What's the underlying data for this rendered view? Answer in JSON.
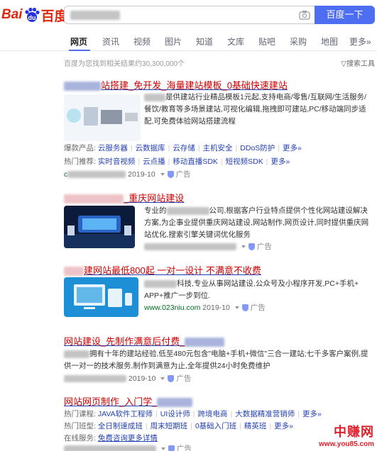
{
  "header": {
    "logo_bai": "Bai",
    "logo_du": "百度",
    "search_button": "百度一下"
  },
  "tabs": [
    "网页",
    "资讯",
    "视频",
    "图片",
    "知道",
    "文库",
    "贴吧",
    "采购",
    "地图",
    "更多»"
  ],
  "stats": "百度为您找到相关结果约30,300,000个",
  "search_tools": "搜索工具",
  "results": {
    "r1": {
      "title_tail": "站搭建_免开发_海量建站模板_0基础快速建站",
      "desc1": "是供建站行业精品模板1元起,支持电商/零售/互联网/生活服务/",
      "desc2": "餐饮/教育等多场景建站,可视化编辑,拖拽即可建站,PC/移动端同步适",
      "desc3": "配,可免费体验网站搭建流程",
      "line_products_label": "爆款产品:",
      "products": [
        "云服务器",
        "云数据库",
        "云存储",
        "主机安全",
        "DDoS防护",
        "更多»"
      ],
      "line_hot_label": "热门推荐:",
      "hot": [
        "实时音视频",
        "云点播",
        "移动直播SDK",
        "短视频SDK",
        "更多»"
      ],
      "date": "2019-10",
      "ad": "广告"
    },
    "r2": {
      "title_tail": "_重庆网站建设",
      "desc1": "公司,根据客户行业特点提供个性化网站建设解决",
      "desc2": "方案,为企事业提供重庆网站建设,网站制作,网页设计,同时提供重庆网",
      "desc3": "站优化,搜索引擎关键词优化服务",
      "ad": "广告"
    },
    "r3": {
      "title_tail": "建网站最低800起 一对一设计 不满意不收费",
      "desc1": "科技,专业从事网站建设,公众号及小程序开发,PC+手机+",
      "desc2": "APP+推广一步到位.",
      "url": "www.023niu.com",
      "date": "2019-10",
      "ad": "广告"
    },
    "r4": {
      "title": "网站建设_先制作满意后付费_",
      "desc1": "拥有十年的建站经验,低至480元包含\"电脑+手机+微信\"三合一建站;七千多客户案例,提",
      "desc2": "供一对一的技术服务,制作到满意为止,全年提供24小时免费维护",
      "date": "2019-10",
      "ad": "广告"
    },
    "r5": {
      "title": "网站网页制作_入门学_",
      "courses_label": "热门课程:",
      "courses": [
        "JAVA软件工程师",
        "UI设计师",
        "跨境电商",
        "大数据精准营销师",
        "更多»"
      ],
      "classes_label": "热门班型:",
      "classes": [
        "全日制速成班",
        "周末短期班",
        "0基础入门班",
        "精英班",
        "更多»"
      ],
      "service_label": "在线服务:",
      "service": "免费咨询更多详情",
      "ad": "广告"
    }
  },
  "watermark": {
    "cn": "中赚网",
    "url": "www.you85.com"
  }
}
